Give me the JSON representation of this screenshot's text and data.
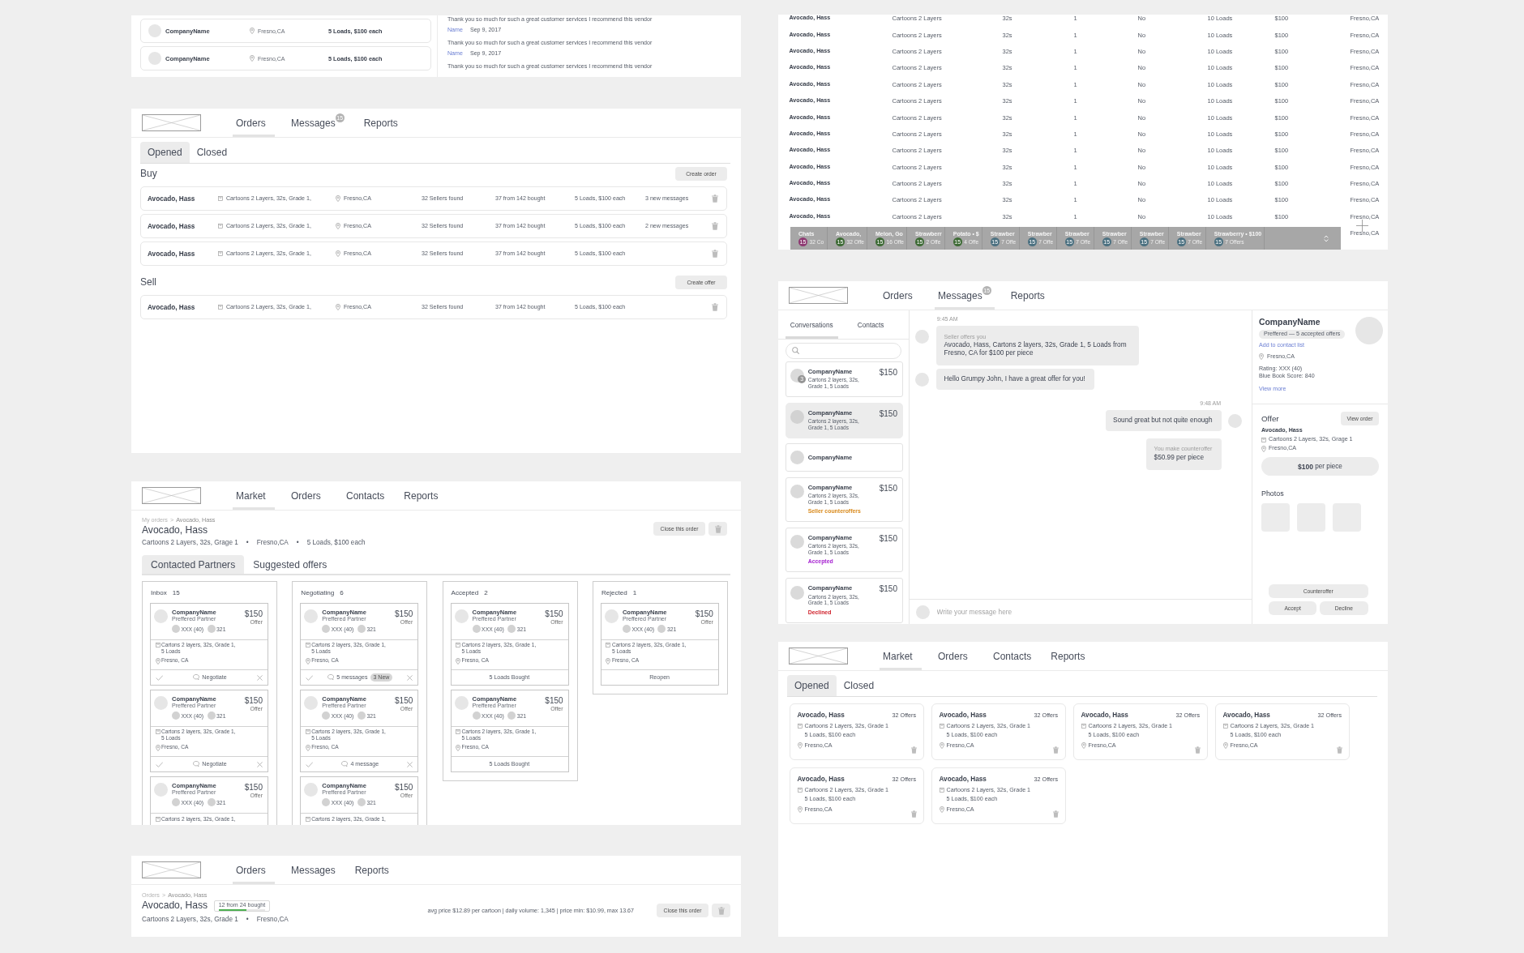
{
  "reviews_panel": {
    "companies": [
      {
        "name": "CompanyName",
        "location": "Fresno,CA",
        "terms": "5 Loads, $100 each"
      },
      {
        "name": "CompanyName",
        "location": "Fresno,CA",
        "terms": "5 Loads, $100 each"
      }
    ],
    "reviews": [
      {
        "text": "Thank you so much for such a great customer services I recommend this vendor",
        "author": "Name",
        "date": "Sep 9, 2017"
      },
      {
        "text": "Thank you so much for such a great customer services I recommend this vendor",
        "author": "Name",
        "date": "Sep 9, 2017"
      },
      {
        "text": "Thank you so much for such a great customer services I recommend this vendor"
      }
    ]
  },
  "orders_panel": {
    "nav": {
      "tabs": [
        {
          "label": "Orders",
          "selected": true
        },
        {
          "label": "Messages",
          "selected": false,
          "badge": "15"
        },
        {
          "label": "Reports",
          "selected": false
        }
      ]
    },
    "filter_tabs": [
      {
        "label": "Opened",
        "selected": true
      },
      {
        "label": "Closed",
        "selected": false
      }
    ],
    "sections": [
      {
        "title": "Buy",
        "action": "Create order",
        "orders": [
          {
            "name": "Avocado, Hass",
            "product": "Cartoons 2 Layers, 32s, Grade 1,",
            "location": "Fresno,CA",
            "sellers": "32 Sellers found",
            "bought": "37 from 142 bought",
            "terms": "5 Loads, $100 each",
            "messages": "3 new messages"
          },
          {
            "name": "Avocado, Hass",
            "product": "Cartoons 2 Layers, 32s, Grade 1,",
            "location": "Fresno,CA",
            "sellers": "32 Sellers found",
            "bought": "37 from 142 bought",
            "terms": "5 Loads, $100 each",
            "messages": "2 new messages"
          },
          {
            "name": "Avocado, Hass",
            "product": "Cartoons 2 Layers, 32s, Grade 1,",
            "location": "Fresno,CA",
            "sellers": "32 Sellers found",
            "bought": "37 from 142 bought",
            "terms": "5 Loads, $100 each"
          }
        ]
      },
      {
        "title": "Sell",
        "action": "Create offer",
        "orders": [
          {
            "name": "Avocado, Hass",
            "product": "Cartoons 2 Layers, 32s, Grade 1,",
            "location": "Fresno,CA",
            "sellers": "32 Sellers found",
            "bought": "37 from 142 bought",
            "terms": "5 Loads, $100 each"
          }
        ]
      }
    ]
  },
  "order_detail_panel": {
    "nav": {
      "tabs": [
        {
          "label": "Market",
          "selected": true
        },
        {
          "label": "Orders",
          "selected": false
        },
        {
          "label": "Contacts",
          "selected": false
        },
        {
          "label": "Reports",
          "selected": false
        }
      ]
    },
    "breadcrumb": [
      "My orders",
      "Avocado, Hass"
    ],
    "breadcrumb_separator": ">",
    "title": "Avocado, Hass",
    "details": [
      "Cartoons 2 Layers, 32s, Grage 1",
      "Fresno,CA",
      "5 Loads, $100 each"
    ],
    "details_separator": "•",
    "close_action": "Close this order",
    "tabs": [
      {
        "label": "Contacted Partners",
        "selected": true
      },
      {
        "label": "Suggested offers",
        "selected": false
      }
    ],
    "columns": [
      {
        "title": "Inbox",
        "count": "15",
        "cards": [
          {
            "company": "CompanyName",
            "tier": "Preffered Partner",
            "rating": "XXX (40)",
            "score": "321",
            "price": "$150",
            "price_note": "Offer",
            "details": "Cartons 2 layers, 32s, Grade 1, 5 Loads",
            "location": "Fresno, CA",
            "footer": {
              "kind": "actions",
              "label": "Negotiate"
            }
          },
          {
            "company": "CompanyName",
            "tier": "Preffered Partner",
            "rating": "XXX (40)",
            "score": "321",
            "price": "$150",
            "price_note": "Offer",
            "details": "Cartons 2 layers, 32s, Grade 1, 5 Loads",
            "location": "Fresno, CA",
            "footer": {
              "kind": "actions",
              "label": "Negotiate"
            }
          },
          {
            "company": "CompanyName",
            "tier": "Preffered Partner",
            "rating": "XXX (40)",
            "score": "321",
            "price": "$150",
            "price_note": "Offer",
            "details": "Cartons 2 layers, 32s, Grade 1,"
          }
        ]
      },
      {
        "title": "Negotiating",
        "count": "6",
        "cards": [
          {
            "company": "CompanyName",
            "tier": "Preffered Partner",
            "rating": "XXX (40)",
            "score": "321",
            "price": "$150",
            "price_note": "Offer",
            "details": "Cartons 2 layers, 32s, Grade 1, 5 Loads",
            "location": "Fresno, CA",
            "footer": {
              "kind": "actions",
              "label": "5 messages",
              "badge": "3 New"
            }
          },
          {
            "company": "CompanyName",
            "tier": "Preffered Partner",
            "rating": "XXX (40)",
            "score": "321",
            "price": "$150",
            "price_note": "Offer",
            "details": "Cartons 2 layers, 32s, Grade 1, 5 Loads",
            "location": "Fresno, CA",
            "footer": {
              "kind": "actions",
              "label": "4 message"
            }
          },
          {
            "company": "CompanyName",
            "tier": "Preffered Partner",
            "rating": "XXX (40)",
            "score": "321",
            "price": "$150",
            "price_note": "Offer",
            "details": "Cartons 2 layers, 32s, Grade 1,"
          }
        ]
      },
      {
        "title": "Accepted",
        "count": "2",
        "cards": [
          {
            "company": "CompanyName",
            "tier": "Preffered Partner",
            "rating": "XXX (40)",
            "score": "321",
            "price": "$150",
            "price_note": "Offer",
            "details": "Cartons 2 layers, 32s, Grade 1, 5 Loads",
            "location": "Fresno, CA",
            "footer": {
              "kind": "note",
              "label": "5 Loads Bought"
            }
          },
          {
            "company": "CompanyName",
            "tier": "Preffered Partner",
            "rating": "XXX (40)",
            "score": "321",
            "price": "$150",
            "price_note": "Offer",
            "details": "Cartons 2 layers, 32s, Grade 1, 5 Loads",
            "location": "Fresno, CA",
            "footer": {
              "kind": "note",
              "label": "5 Loads Bought"
            }
          }
        ]
      },
      {
        "title": "Rejected",
        "count": "1",
        "cards": [
          {
            "company": "CompanyName",
            "tier": "Preffered Partner",
            "rating": "XXX (40)",
            "score": "321",
            "price": "$150",
            "price_note": "Offer",
            "details": "Cartons 2 layers, 32s, Grade 1, 5 Loads",
            "location": "Fresno, CA",
            "footer": {
              "kind": "button",
              "label": "Reopen"
            }
          }
        ]
      }
    ]
  },
  "order_summary_panel": {
    "nav": {
      "tabs": [
        {
          "label": "Orders",
          "selected": true
        },
        {
          "label": "Messages",
          "selected": false
        },
        {
          "label": "Reports",
          "selected": false
        }
      ]
    },
    "breadcrumb": [
      "Orders",
      "Avocado, Hass"
    ],
    "breadcrumb_separator": ">",
    "title": "Avocado, Hass",
    "progress": {
      "label": "12 from 24 bought",
      "level": 0.6
    },
    "details": [
      "Cartoons 2 Layers, 32s, Grade 1",
      "Fresno,CA"
    ],
    "details_separator": "•",
    "stats": "avg price $12.89 per cartoon | daily volume: 1,345 | price min: $10.99, max 13.67",
    "close_action": "Close this order"
  },
  "listings_panel": {
    "table": {
      "rows": [
        {
          "column_1": "Avocado, Hass",
          "column_2": "Cartoons 2 Layers",
          "column_3": "32s",
          "column_4": "1",
          "column_5": "No",
          "column_6": "10 Loads",
          "column_7": "$100",
          "column_8": "Fresno,CA"
        },
        {
          "column_1": "Avocado, Hass",
          "column_2": "Cartoons 2 Layers",
          "column_3": "32s",
          "column_4": "1",
          "column_5": "No",
          "column_6": "10 Loads",
          "column_7": "$100",
          "column_8": "Fresno,CA"
        },
        {
          "column_1": "Avocado, Hass",
          "column_2": "Cartoons 2 Layers",
          "column_3": "32s",
          "column_4": "1",
          "column_5": "No",
          "column_6": "10 Loads",
          "column_7": "$100",
          "column_8": "Fresno,CA"
        },
        {
          "column_1": "Avocado, Hass",
          "column_2": "Cartoons 2 Layers",
          "column_3": "32s",
          "column_4": "1",
          "column_5": "No",
          "column_6": "10 Loads",
          "column_7": "$100",
          "column_8": "Fresno,CA"
        },
        {
          "column_1": "Avocado, Hass",
          "column_2": "Cartoons 2 Layers",
          "column_3": "32s",
          "column_4": "1",
          "column_5": "No",
          "column_6": "10 Loads",
          "column_7": "$100",
          "column_8": "Fresno,CA"
        },
        {
          "column_1": "Avocado, Hass",
          "column_2": "Cartoons 2 Layers",
          "column_3": "32s",
          "column_4": "1",
          "column_5": "No",
          "column_6": "10 Loads",
          "column_7": "$100",
          "column_8": "Fresno,CA"
        },
        {
          "column_1": "Avocado, Hass",
          "column_2": "Cartoons 2 Layers",
          "column_3": "32s",
          "column_4": "1",
          "column_5": "No",
          "column_6": "10 Loads",
          "column_7": "$100",
          "column_8": "Fresno,CA"
        },
        {
          "column_1": "Avocado, Hass",
          "column_2": "Cartoons 2 Layers",
          "column_3": "32s",
          "column_4": "1",
          "column_5": "No",
          "column_6": "10 Loads",
          "column_7": "$100",
          "column_8": "Fresno,CA"
        },
        {
          "column_1": "Avocado, Hass",
          "column_2": "Cartoons 2 Layers",
          "column_3": "32s",
          "column_4": "1",
          "column_5": "No",
          "column_6": "10 Loads",
          "column_7": "$100",
          "column_8": "Fresno,CA"
        },
        {
          "column_1": "Avocado, Hass",
          "column_2": "Cartoons 2 Layers",
          "column_3": "32s",
          "column_4": "1",
          "column_5": "No",
          "column_6": "10 Loads",
          "column_7": "$100",
          "column_8": "Fresno,CA"
        },
        {
          "column_1": "Avocado, Hass",
          "column_2": "Cartoons 2 Layers",
          "column_3": "32s",
          "column_4": "1",
          "column_5": "No",
          "column_6": "10 Loads",
          "column_7": "$100",
          "column_8": "Fresno,CA"
        },
        {
          "column_1": "Avocado, Hass",
          "column_2": "Cartoons 2 Layers",
          "column_3": "32s",
          "column_4": "1",
          "column_5": "No",
          "column_6": "10 Loads",
          "column_7": "$100",
          "column_8": "Fresno,CA"
        },
        {
          "column_1": "Avocado, Hass",
          "column_2": "Cartoons 2 Layers",
          "column_3": "32s",
          "column_4": "1",
          "column_5": "No",
          "column_6": "10 Loads",
          "column_7": "$100",
          "column_8": "Fresno,CA"
        },
        {
          "column_8": "Fresno,CA"
        }
      ]
    },
    "chats": [
      {
        "title": "Chats",
        "count": "15",
        "subtitle": "32 Co",
        "color": "#8e3a72"
      },
      {
        "title": "Avocado,",
        "count": "15",
        "subtitle": "32 Offe",
        "color": "#3d6a35"
      },
      {
        "title": "Melon, Go",
        "count": "15",
        "subtitle": "16 Offe",
        "color": "#3d6a35"
      },
      {
        "title": "Strawberr",
        "count": "15",
        "subtitle": "2 Offe",
        "color": "#3d6a35"
      },
      {
        "title": "Potato • $",
        "count": "15",
        "subtitle": "4 Offe",
        "color": "#3d6a35"
      },
      {
        "title": "Strawber",
        "count": "15",
        "subtitle": "7 Offe",
        "color": "#4b7080"
      },
      {
        "title": "Strawber",
        "count": "15",
        "subtitle": "7 Offe",
        "color": "#4b7080"
      },
      {
        "title": "Strawber",
        "count": "15",
        "subtitle": "7 Offe",
        "color": "#4b7080"
      },
      {
        "title": "Strawber",
        "count": "15",
        "subtitle": "7 Offe",
        "color": "#4b7080"
      },
      {
        "title": "Strawber",
        "count": "15",
        "subtitle": "7 Offe",
        "color": "#4b7080"
      },
      {
        "title": "Strawber",
        "count": "15",
        "subtitle": "7 Offe",
        "color": "#4b7080"
      },
      {
        "title": "Strawberry • $100",
        "count": "15",
        "subtitle": "7 Offers",
        "color": "#4b7080"
      }
    ]
  },
  "messages_panel": {
    "nav": {
      "tabs": [
        {
          "label": "Orders",
          "selected": false
        },
        {
          "label": "Messages",
          "selected": true,
          "badge": "15"
        },
        {
          "label": "Reports",
          "selected": false
        }
      ]
    },
    "sidebar_tabs": [
      {
        "label": "Conversations",
        "selected": true
      },
      {
        "label": "Contacts",
        "selected": false
      }
    ],
    "conversations": [
      {
        "company": "CompanyName",
        "price": "$150",
        "details": "Cartons 2 layers, 32s, Grade 1, 5 Loads",
        "badge": "3",
        "selected": false
      },
      {
        "company": "CompanyName",
        "price": "$150",
        "details": "Cartons 2 layers, 32s, Grade 1, 5 Loads",
        "selected": true
      },
      {
        "company": "CompanyName",
        "selected": false
      },
      {
        "company": "CompanyName",
        "price": "$150",
        "details": "Cartons 2 layers, 32s, Grade 1, 5 Loads",
        "status": "Seller counteroffers",
        "color": "#d98a1c",
        "selected": false
      },
      {
        "company": "CompanyName",
        "price": "$150",
        "details": "Cartons 2 layers, 32s, Grade 1, 5 Loads",
        "status": "Accepted",
        "color": "#a51fd0",
        "selected": false
      },
      {
        "company": "CompanyName",
        "price": "$150",
        "details": "Cartons 2 layers, 32s, Grade 1, 5 Loads",
        "status": "Declined",
        "color": "#d0222c",
        "selected": false
      }
    ],
    "thread": [
      {
        "kind": "timestamp",
        "outgoing": false,
        "text": "9:45 AM"
      },
      {
        "kind": "message",
        "outgoing": false,
        "avatar": true,
        "label": "Seller offers you",
        "text": "Avocado, Hass, Cartons 2 layers, 32s, Grade 1, 5 Loads from Fresno, CA for $100 per piece"
      },
      {
        "kind": "message",
        "outgoing": false,
        "avatar": true,
        "text": "Hello Grumpy John, I have a great offer for you!"
      },
      {
        "kind": "timestamp",
        "outgoing": true,
        "text": "9:48 AM"
      },
      {
        "kind": "message",
        "outgoing": true,
        "avatar": true,
        "text": "Sound great but not quite enough"
      },
      {
        "kind": "message",
        "outgoing": true,
        "avatar": false,
        "label": "You make counteroffer",
        "text": "$50.99 per piece"
      }
    ],
    "composer": {
      "placeholder": "Write your message here"
    },
    "profile": {
      "name": "CompanyName",
      "badge": "Preffered — 5 accepted offers",
      "link": "Add to contact list",
      "location": "Fresno,CA",
      "rating": "Rating: XXX (40)",
      "score": "Blue Book Score: 840",
      "more": "View more"
    },
    "offer": {
      "title": "Offer",
      "action": "View order",
      "product": "Avocado, Hass",
      "details": "Cartoons 2 Layers, 32s, Grage 1",
      "location": "Fresno,CA",
      "price": "**$100** per piece",
      "photos_title": "Photos"
    },
    "actions": [
      "Counteroffer",
      "Accept",
      "Decline"
    ]
  },
  "market_panel": {
    "nav": {
      "tabs": [
        {
          "label": "Market",
          "selected": true
        },
        {
          "label": "Orders",
          "selected": false
        },
        {
          "label": "Contacts",
          "selected": false
        },
        {
          "label": "Reports",
          "selected": false
        }
      ]
    },
    "filter_tabs": [
      {
        "label": "Opened",
        "selected": true
      },
      {
        "label": "Closed",
        "selected": false
      }
    ],
    "listings": [
      {
        "name": "Avocado, Hass",
        "offers": "32 Offers",
        "product": "Cartoons 2 Layers, 32s, Grade 1",
        "terms": "5 Loads, $100 each",
        "location": "Fresno,CA"
      },
      {
        "name": "Avocado, Hass",
        "offers": "32 Offers",
        "product": "Cartoons 2 Layers, 32s, Grade 1",
        "terms": "5 Loads, $100 each",
        "location": "Fresno,CA"
      },
      {
        "name": "Avocado, Hass",
        "offers": "32 Offers",
        "product": "Cartoons 2 Layers, 32s, Grade 1",
        "terms": "5 Loads, $100 each",
        "location": "Fresno,CA"
      },
      {
        "name": "Avocado, Hass",
        "offers": "32 Offers",
        "product": "Cartoons 2 Layers, 32s, Grade 1",
        "terms": "5 Loads, $100 each",
        "location": "Fresno,CA"
      },
      {
        "name": "Avocado, Hass",
        "offers": "32 Offers",
        "product": "Cartoons 2 Layers, 32s, Grade 1",
        "terms": "5 Loads, $100 each",
        "location": "Fresno,CA"
      },
      {
        "name": "Avocado, Hass",
        "offers": "32 Offers",
        "product": "Cartoons 2 Layers, 32s, Grade 1",
        "terms": "5 Loads, $100 each",
        "location": "Fresno,CA"
      }
    ]
  }
}
